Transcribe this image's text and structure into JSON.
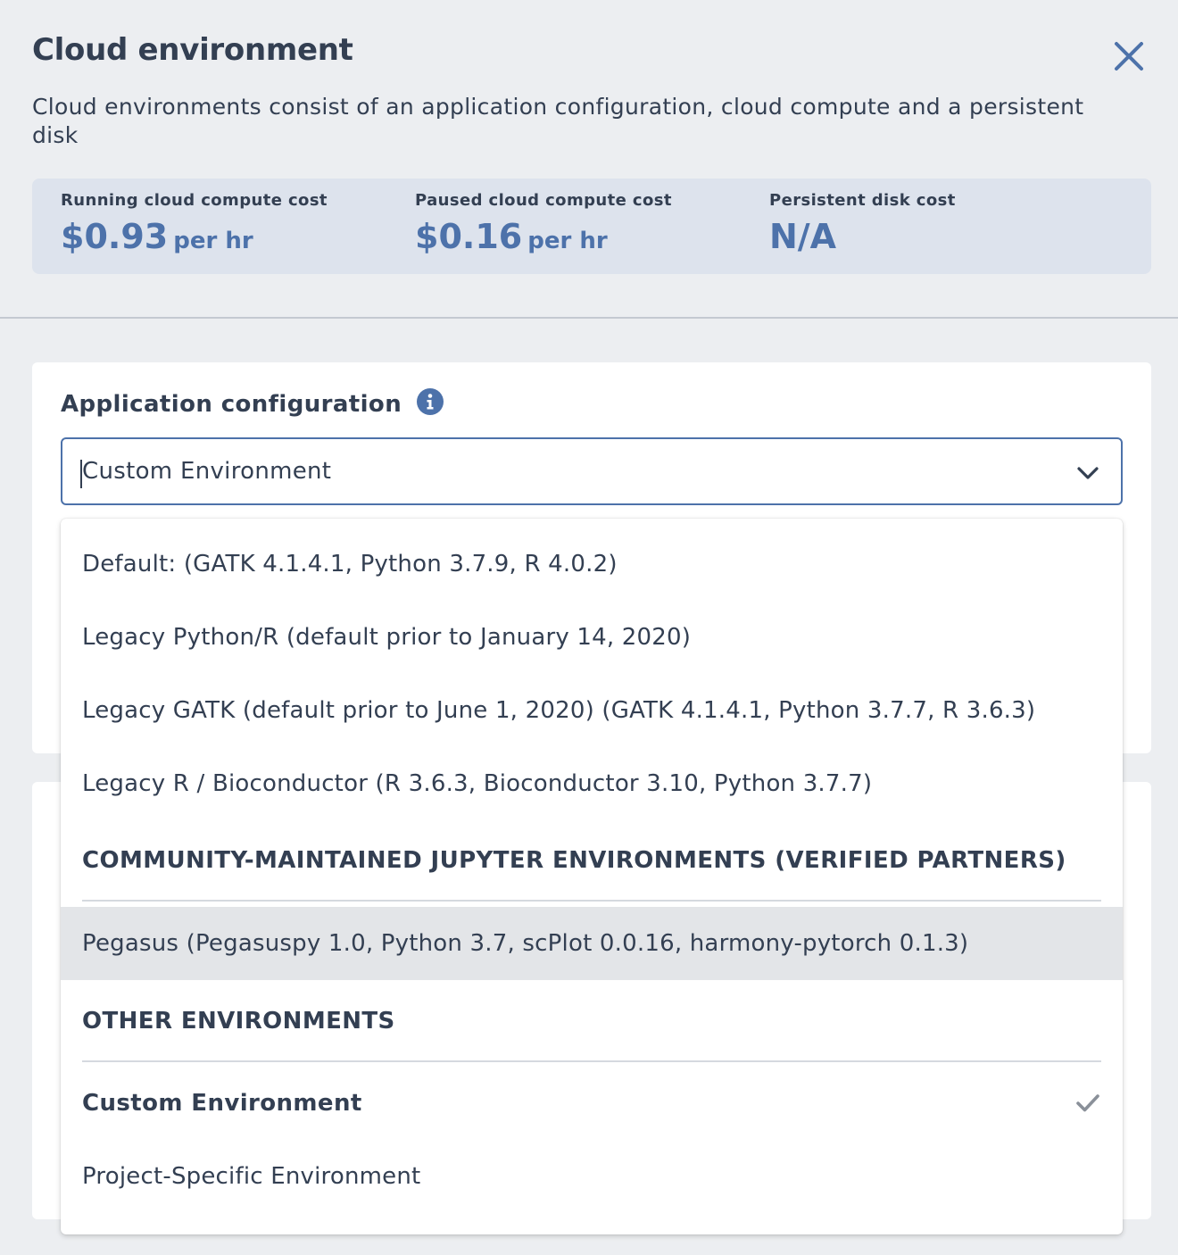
{
  "header": {
    "title": "Cloud environment",
    "close_icon": "close-icon",
    "description": "Cloud environments consist of an application configuration, cloud compute and a persistent disk"
  },
  "costs": {
    "running": {
      "label": "Running cloud compute cost",
      "amount": "$0.93",
      "unit": "per hr"
    },
    "paused": {
      "label": "Paused cloud compute cost",
      "amount": "$0.16",
      "unit": "per hr"
    },
    "disk": {
      "label": "Persistent disk cost",
      "amount": "N/A"
    }
  },
  "app_config": {
    "label": "Application configuration",
    "info_icon": "info-icon",
    "selected_value": "Custom Environment",
    "chevron_icon": "chevron-down-icon"
  },
  "dropdown": {
    "options": [
      "Default: (GATK 4.1.4.1, Python 3.7.9, R 4.0.2)",
      "Legacy Python/R (default prior to January 14, 2020)",
      "Legacy GATK (default prior to June 1, 2020) (GATK 4.1.4.1, Python 3.7.7, R 3.6.3)",
      "Legacy R / Bioconductor (R 3.6.3, Bioconductor 3.10, Python 3.7.7)"
    ],
    "community_header": "COMMUNITY-MAINTAINED JUPYTER ENVIRONMENTS (VERIFIED PARTNERS)",
    "community_options": [
      "Pegasus (Pegasuspy 1.0, Python 3.7, scPlot 0.0.16, harmony-pytorch 0.1.3)"
    ],
    "other_header": "OTHER ENVIRONMENTS",
    "other_options": [
      "Custom Environment",
      "Project-Specific Environment"
    ],
    "check_icon": "check-icon"
  },
  "colors": {
    "accent": "#4d72aa",
    "text": "#333f52",
    "background": "#eceef1",
    "cost_panel": "#dde3ed",
    "highlight": "#e3e5e8"
  }
}
